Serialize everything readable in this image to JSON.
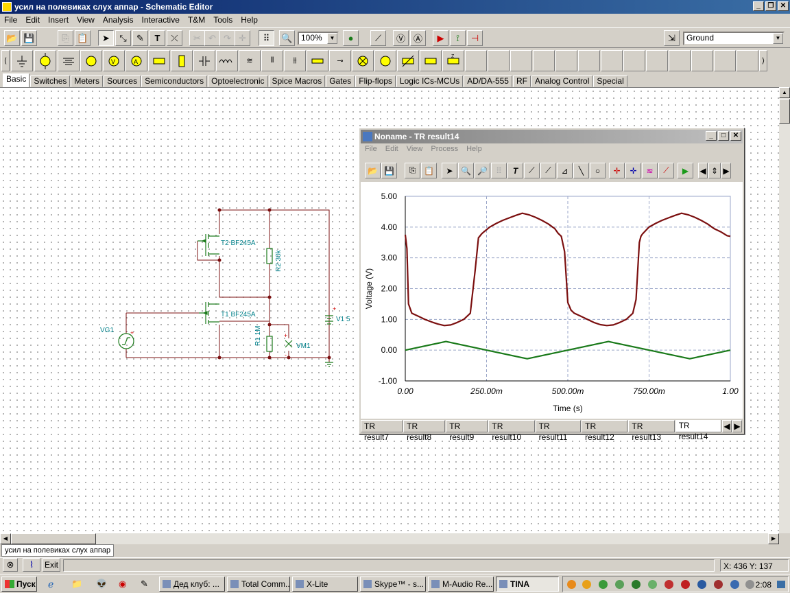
{
  "window": {
    "title": "усил на полевиках слух аппар - Schematic Editor"
  },
  "menu": [
    "File",
    "Edit",
    "Insert",
    "View",
    "Analysis",
    "Interactive",
    "T&M",
    "Tools",
    "Help"
  ],
  "toolbar": {
    "zoom": "100%",
    "net_combo": "Ground"
  },
  "component_tabs": [
    "Basic",
    "Switches",
    "Meters",
    "Sources",
    "Semiconductors",
    "Optoelectronic",
    "Spice Macros",
    "Gates",
    "Flip-flops",
    "Logic ICs-MCUs",
    "AD/DA-555",
    "RF",
    "Analog Control",
    "Special"
  ],
  "schematic": {
    "labels": {
      "t2": "T2 BF245A",
      "t1": "T1 BF245A",
      "r2": "R2 30k",
      "r1": "R1 1M",
      "vg1": "VG1",
      "v1": "V1 5",
      "vm1": "VM1"
    }
  },
  "result_window": {
    "title": "Noname - TR result14",
    "menu": [
      "File",
      "Edit",
      "View",
      "Process",
      "Help"
    ],
    "tabs": [
      "TR result7",
      "TR result8",
      "TR result9",
      "TR result10",
      "TR result11",
      "TR result12",
      "TR result13",
      "TR result14"
    ]
  },
  "chart_data": {
    "type": "line",
    "xlabel": "Time (s)",
    "ylabel": "Voltage (V)",
    "xlim": [
      0,
      1.0
    ],
    "ylim": [
      -1.0,
      5.0
    ],
    "xticks": [
      "0.00",
      "250.00m",
      "500.00m",
      "750.00m",
      "1.00"
    ],
    "yticks": [
      "-1.00",
      "0.00",
      "1.00",
      "2.00",
      "3.00",
      "4.00",
      "5.00"
    ],
    "grid": true,
    "series": [
      {
        "color": "#7b0f0f",
        "x": [
          0,
          0.005,
          0.01,
          0.02,
          0.04,
          0.06,
          0.08,
          0.1,
          0.12,
          0.14,
          0.16,
          0.18,
          0.2,
          0.215,
          0.225,
          0.235,
          0.24,
          0.26,
          0.28,
          0.3,
          0.32,
          0.34,
          0.36,
          0.38,
          0.4,
          0.42,
          0.44,
          0.46,
          0.47,
          0.48,
          0.49,
          0.5,
          0.51,
          0.52,
          0.54,
          0.56,
          0.58,
          0.6,
          0.62,
          0.64,
          0.66,
          0.68,
          0.69,
          0.7,
          0.71,
          0.72,
          0.725,
          0.73,
          0.75,
          0.77,
          0.79,
          0.81,
          0.83,
          0.85,
          0.87,
          0.89,
          0.91,
          0.93,
          0.95,
          0.97,
          0.99,
          1.0
        ],
        "y": [
          3.75,
          3.3,
          1.5,
          1.2,
          1.1,
          1.0,
          0.92,
          0.85,
          0.8,
          0.82,
          0.9,
          1.0,
          1.2,
          2.6,
          3.65,
          3.78,
          3.83,
          4.0,
          4.12,
          4.22,
          4.3,
          4.38,
          4.45,
          4.4,
          4.32,
          4.22,
          4.1,
          3.95,
          3.8,
          3.7,
          3.2,
          1.55,
          1.3,
          1.2,
          1.1,
          1.0,
          0.9,
          0.83,
          0.8,
          0.82,
          0.9,
          1.0,
          1.1,
          1.2,
          1.65,
          3.5,
          3.7,
          3.78,
          4.0,
          4.12,
          4.22,
          4.3,
          4.38,
          4.45,
          4.4,
          4.32,
          4.22,
          4.1,
          3.95,
          3.85,
          3.72,
          3.7
        ]
      },
      {
        "color": "#1a7a1a",
        "x": [
          0,
          0.125,
          0.375,
          0.625,
          0.875,
          1.0
        ],
        "y": [
          0.0,
          0.28,
          -0.28,
          0.28,
          -0.28,
          0.0
        ]
      }
    ]
  },
  "document_tab": "усил на полевиках слух аппар",
  "bottom": {
    "exit": "Exit",
    "coords": "X: 436  Y: 137"
  },
  "taskbar": {
    "start": "Пуск",
    "tasks": [
      "Дед клуб: ...",
      "Total Comm...",
      "X-Lite",
      "Skype™ - s...",
      "M-Audio Re...",
      "TINA"
    ],
    "clock": "2:08"
  }
}
